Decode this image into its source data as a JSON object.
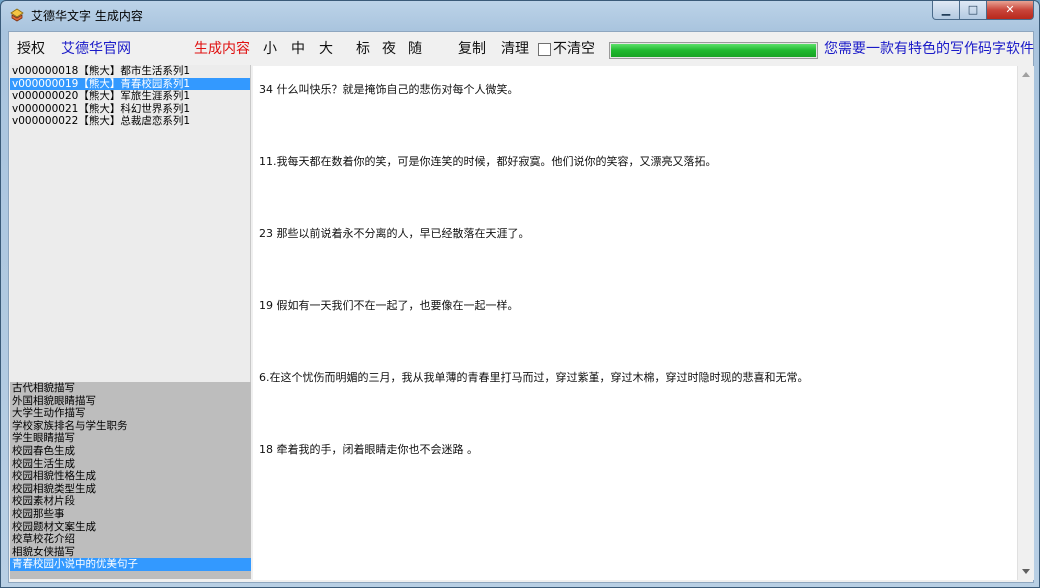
{
  "window": {
    "title": "艾德华文字 生成内容",
    "controls": {
      "minimize": "▁",
      "maximize": "□",
      "close": "✕"
    }
  },
  "toolbar": {
    "auth": "授权",
    "website": "艾德华官网",
    "generate": "生成内容",
    "size_small": "小",
    "size_medium": "中",
    "size_large": "大",
    "style_standard": "标",
    "style_night": "夜",
    "style_random": "随",
    "copy": "复制",
    "clear": "清理",
    "no_clear_label": "不清空",
    "no_clear_checked": false,
    "progress_percent": 100,
    "promo": "您需要一款有特色的写作码字软件"
  },
  "series_list": [
    {
      "label": "v000000018【熊大】都市生活系列1",
      "selected": false
    },
    {
      "label": "v000000019【熊大】青春校园系列1",
      "selected": true
    },
    {
      "label": "v000000020【熊大】军旅生涯系列1",
      "selected": false
    },
    {
      "label": "v000000021【熊大】科幻世界系列1",
      "selected": false
    },
    {
      "label": "v000000022【熊大】总裁虐恋系列1",
      "selected": false
    }
  ],
  "category_list": [
    {
      "label": "古代相貌描写",
      "selected": false
    },
    {
      "label": "外国相貌眼睛描写",
      "selected": false
    },
    {
      "label": "大学生动作描写",
      "selected": false
    },
    {
      "label": "学校家族排名与学生职务",
      "selected": false
    },
    {
      "label": "学生眼睛描写",
      "selected": false
    },
    {
      "label": "校园春色生成",
      "selected": false
    },
    {
      "label": "校园生活生成",
      "selected": false
    },
    {
      "label": "校园相貌性格生成",
      "selected": false
    },
    {
      "label": "校园相貌类型生成",
      "selected": false
    },
    {
      "label": "校园素材片段",
      "selected": false
    },
    {
      "label": "校园那些事",
      "selected": false
    },
    {
      "label": "校园题材文案生成",
      "selected": false
    },
    {
      "label": "校草校花介绍",
      "selected": false
    },
    {
      "label": "相貌女侠描写",
      "selected": false
    },
    {
      "label": "青春校园小说中的优美句子",
      "selected": true
    }
  ],
  "content": {
    "paragraphs": [
      "34 什么叫快乐？就是掩饰自己的悲伤对每个人微笑。",
      "11.我每天都在数着你的笑，可是你连笑的时候，都好寂寞。他们说你的笑容，又漂亮又落拓。",
      "23 那些以前说着永不分离的人，早已经散落在天涯了。",
      "19 假如有一天我们不在一起了，也要像在一起一样。",
      "6.在这个忧伤而明媚的三月，我从我单薄的青春里打马而过，穿过紫堇，穿过木棉，穿过时隐时现的悲喜和无常。",
      "18 牵着我的手，闭着眼睛走你也不会迷路 。"
    ]
  },
  "colors": {
    "selection": "#3399ff",
    "link_blue": "#1a1ac8",
    "generate_red": "#e01010",
    "progress_green": "#1fb82e"
  }
}
